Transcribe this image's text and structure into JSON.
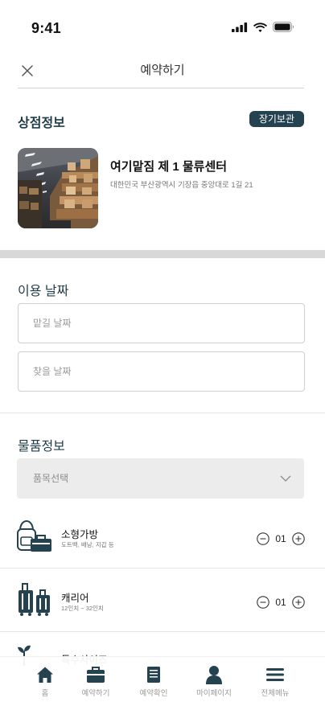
{
  "status_bar": {
    "time": "9:41"
  },
  "nav": {
    "title": "예약하기",
    "close_icon": "close-icon"
  },
  "store_section": {
    "title": "상점정보",
    "badge": "장기보관",
    "store_name": "여기맡짐 제 1 물류센터",
    "store_address": "대한민국 부산광역시 기장읍 중앙대로 1길 21"
  },
  "date_section": {
    "title": "이용 날짜",
    "dropoff_placeholder": "맡길 날짜",
    "pickup_placeholder": "찾을 날짜"
  },
  "item_section": {
    "title": "물품정보",
    "select_placeholder": "품목선택",
    "items": [
      {
        "name": "소형가방",
        "desc": "도트백, 배낭, 지갑 등",
        "quantity": "01",
        "icon": "small-bag-icon"
      },
      {
        "name": "캐리어",
        "desc": "12인치 ~ 32인치",
        "quantity": "01",
        "icon": "carrier-icon"
      },
      {
        "name": "특수사이즈",
        "icon": "special-size-icon"
      }
    ]
  },
  "tab_bar": {
    "tabs": [
      {
        "label": "홈",
        "icon": "home-icon"
      },
      {
        "label": "예약하기",
        "icon": "briefcase-icon"
      },
      {
        "label": "예약확인",
        "icon": "book-icon"
      },
      {
        "label": "마이페이지",
        "icon": "person-icon"
      },
      {
        "label": "전체메뉴",
        "icon": "menu-icon"
      }
    ]
  },
  "colors": {
    "accent": "#24424f",
    "divider": "#d8d8d8",
    "field_bg": "#ececec"
  }
}
